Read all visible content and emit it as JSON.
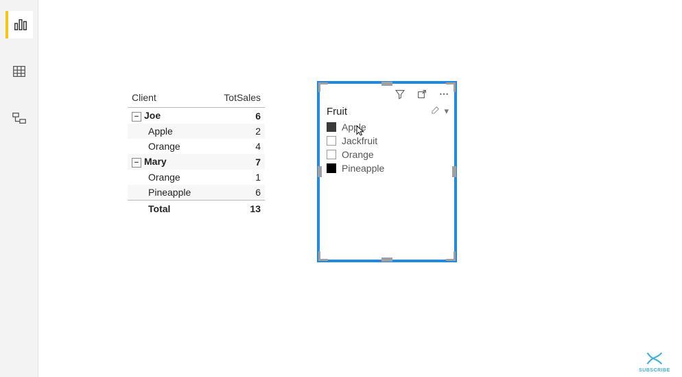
{
  "nav": {
    "report": "Report view",
    "data": "Data view",
    "model": "Model view"
  },
  "matrix": {
    "col1": "Client",
    "col2": "TotSales",
    "groups": [
      {
        "name": "Joe",
        "value": 6,
        "rows": [
          {
            "label": "Apple",
            "value": 2
          },
          {
            "label": "Orange",
            "value": 4
          }
        ]
      },
      {
        "name": "Mary",
        "value": 7,
        "rows": [
          {
            "label": "Orange",
            "value": 1
          },
          {
            "label": "Pineapple",
            "value": 6
          }
        ]
      }
    ],
    "total_label": "Total",
    "total_value": 13
  },
  "slicer": {
    "title": "Fruit",
    "eraser": "Clear selections",
    "chevron": "▾",
    "items": [
      {
        "label": "Apple",
        "checked": "dark"
      },
      {
        "label": "Jackfruit",
        "checked": ""
      },
      {
        "label": "Orange",
        "checked": ""
      },
      {
        "label": "Pineapple",
        "checked": "black"
      }
    ],
    "header_icons": [
      "filter",
      "focus",
      "more"
    ]
  },
  "subscribe": "SUBSCRIBE"
}
